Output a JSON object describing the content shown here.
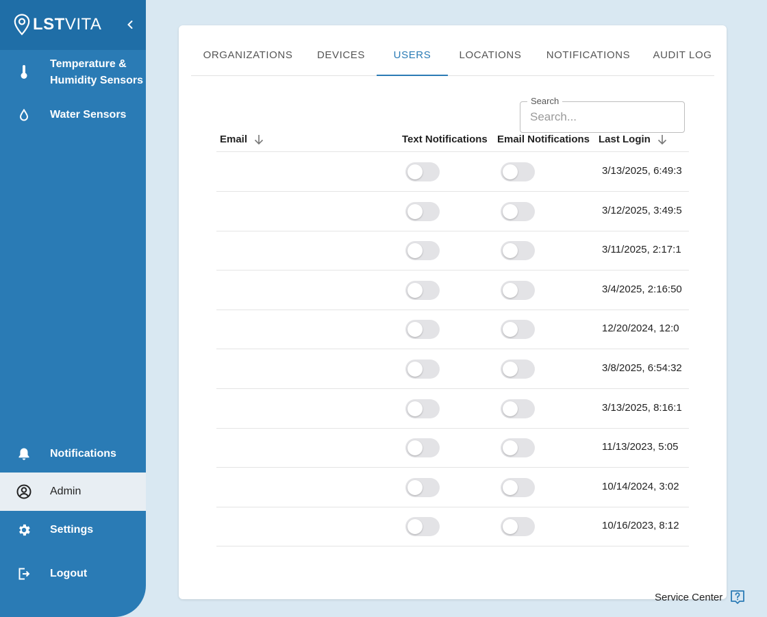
{
  "brand": {
    "logo_bold": "LST",
    "logo_light": "VITA"
  },
  "sidebar": {
    "top_items": [
      {
        "label_line1": "Temperature &",
        "label_line2": "Humidity Sensors",
        "icon": "thermometer-icon"
      },
      {
        "label": "Water Sensors",
        "icon": "water-drop-icon"
      }
    ],
    "bottom_items": [
      {
        "label": "Notifications",
        "icon": "bell-icon"
      },
      {
        "label": "Admin",
        "icon": "user-circle-icon",
        "active": true
      },
      {
        "label": "Settings",
        "icon": "gear-icon"
      },
      {
        "label": "Logout",
        "icon": "logout-icon"
      }
    ]
  },
  "tabs": [
    {
      "label": "ORGANIZATIONS"
    },
    {
      "label": "DEVICES"
    },
    {
      "label": "USERS",
      "active": true
    },
    {
      "label": "LOCATIONS"
    },
    {
      "label": "NOTIFICATIONS"
    },
    {
      "label": "AUDIT LOG"
    }
  ],
  "search": {
    "legend": "Search",
    "placeholder": "Search..."
  },
  "table": {
    "headers": {
      "email": "Email",
      "text_notifications": "Text Notifications",
      "email_notifications": "Email Notifications",
      "last_login": "Last Login"
    },
    "rows": [
      {
        "last_login": "3/13/2025, 6:49:3",
        "text_on": false,
        "email_on": false
      },
      {
        "last_login": "3/12/2025, 3:49:5",
        "text_on": false,
        "email_on": false
      },
      {
        "last_login": "3/11/2025, 2:17:1",
        "text_on": false,
        "email_on": false
      },
      {
        "last_login": "3/4/2025, 2:16:50",
        "text_on": false,
        "email_on": false
      },
      {
        "last_login": "12/20/2024, 12:0",
        "text_on": false,
        "email_on": false
      },
      {
        "last_login": "3/8/2025, 6:54:32",
        "text_on": false,
        "email_on": false
      },
      {
        "last_login": "3/13/2025, 8:16:1",
        "text_on": false,
        "email_on": false
      },
      {
        "last_login": "11/13/2023, 5:05",
        "text_on": false,
        "email_on": false
      },
      {
        "last_login": "10/14/2024, 3:02",
        "text_on": false,
        "email_on": false
      },
      {
        "last_login": "10/16/2023, 8:12",
        "text_on": false,
        "email_on": false
      }
    ]
  },
  "footer": {
    "service_center": "Service Center"
  },
  "colors": {
    "primary": "#2a7bb5",
    "brand_bar": "#1f6ea7",
    "background": "#d9e8f2",
    "toggle_off": "#e3e3e6"
  }
}
